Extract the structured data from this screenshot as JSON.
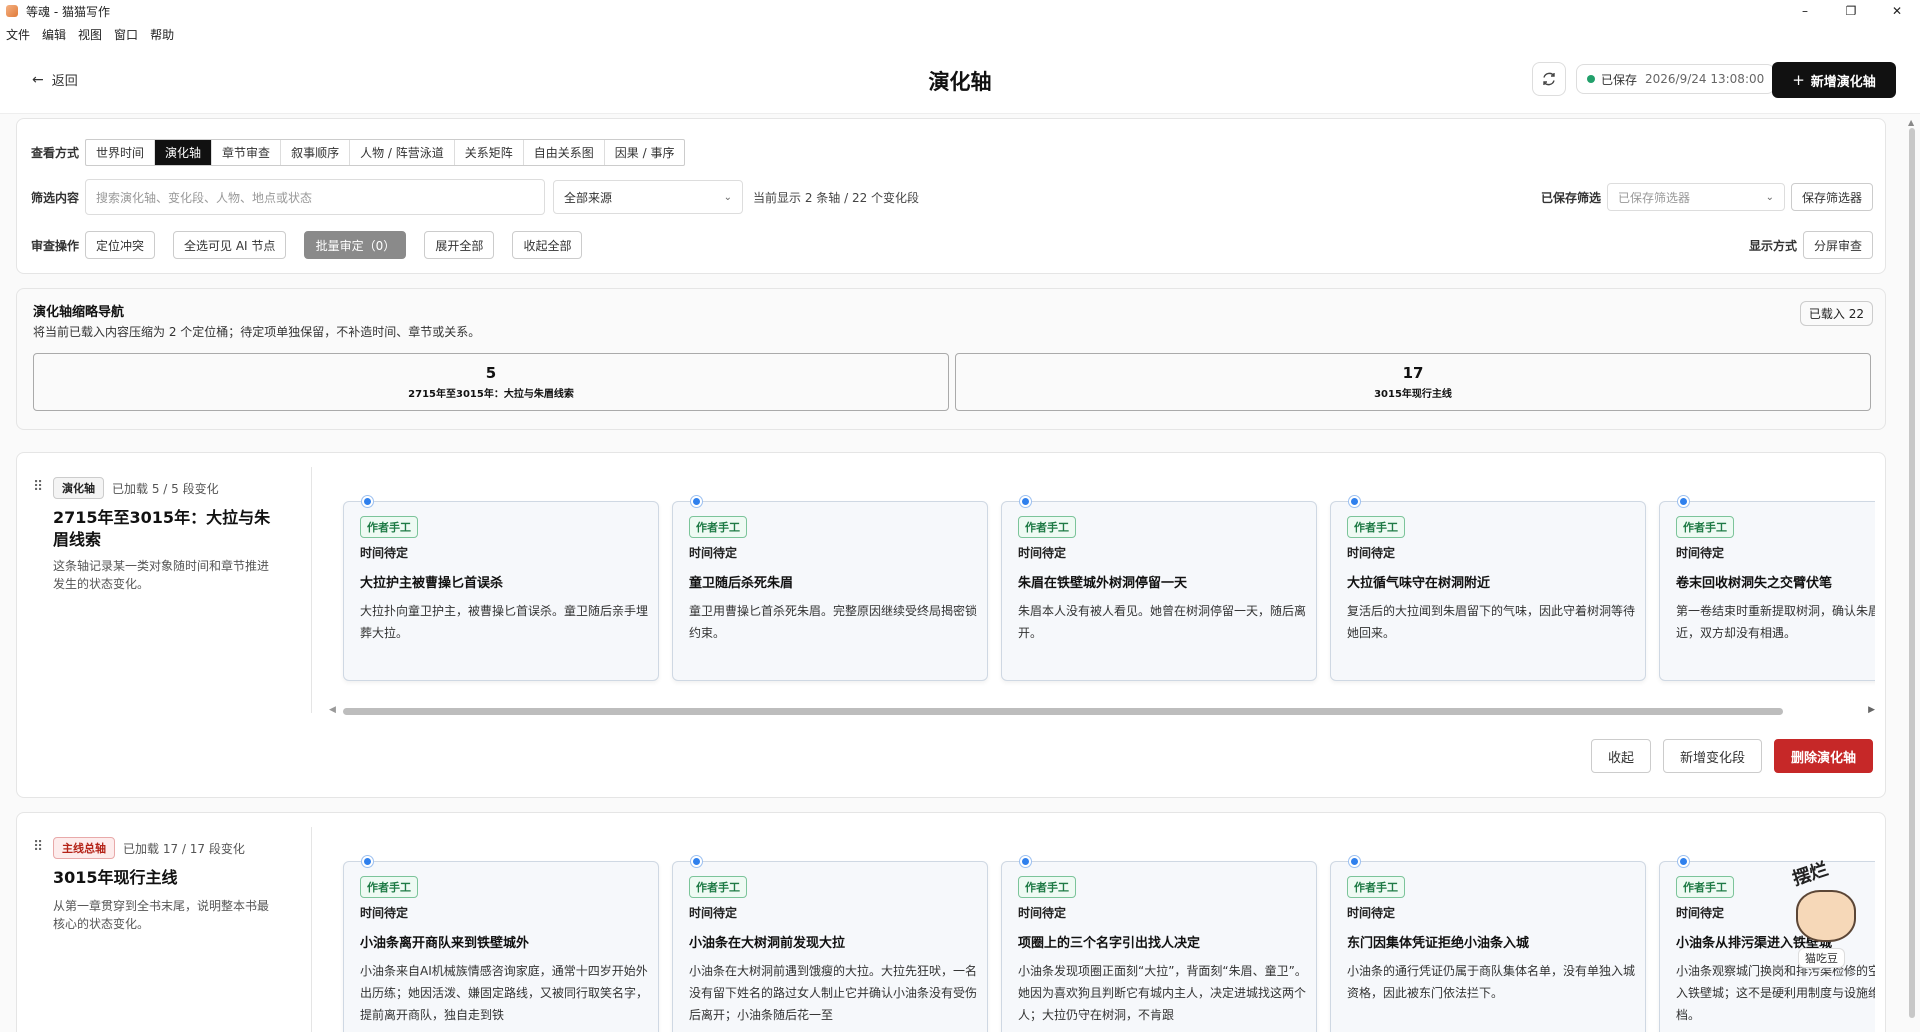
{
  "window": {
    "title": "等魂 - 猫猫写作",
    "controls": [
      "–",
      "❐",
      "✕"
    ]
  },
  "menu": [
    "文件",
    "编辑",
    "视图",
    "窗口",
    "帮助"
  ],
  "header": {
    "back_label": "返回",
    "title": "演化轴",
    "saved_label": "已保存",
    "saved_time": "2026/9/24 13:08:00",
    "new_axis_label": "新增演化轴",
    "status_color": "#22a06b"
  },
  "view_mode": {
    "label": "查看方式",
    "options": [
      "世界时间",
      "演化轴",
      "章节审查",
      "叙事顺序",
      "人物 / 阵营泳道",
      "关系矩阵",
      "自由关系图",
      "因果 / 事序"
    ],
    "active": "演化轴"
  },
  "filter": {
    "label": "筛选内容",
    "search_placeholder": "搜索演化轴、变化段、人物、地点或状态",
    "source_select": "全部来源",
    "count_text": "当前显示 2 条轴 / 22 个变化段",
    "saved_filters_label": "已保存筛选",
    "saved_filters_placeholder": "已保存筛选器",
    "save_filter_button": "保存筛选器"
  },
  "review": {
    "label": "审查操作",
    "buttons": [
      "定位冲突",
      "全选可见 AI 节点",
      "批量审定（0）",
      "展开全部",
      "收起全部"
    ],
    "display_label": "显示方式",
    "display_button": "分屏审查"
  },
  "nav": {
    "title": "演化轴缩略导航",
    "desc": "将当前已载入内容压缩为 2 个定位桶；待定项单独保留，不补造时间、章节或关系。",
    "loaded_badge": "已载入 22",
    "buckets": [
      {
        "count": "5",
        "label": "2715年至3015年：大拉与朱眉线索"
      },
      {
        "count": "17",
        "label": "3015年现行主线"
      }
    ]
  },
  "axes": [
    {
      "tag": "演化轴",
      "loaded": "已加载 5 / 5 段变化",
      "name": "2715年至3015年：大拉与朱眉线索",
      "desc": "这条轴记录某一类对象随时间和章节推进发生的状态变化。",
      "cards": [
        {
          "source": "作者手工",
          "time": "时间待定",
          "title": "大拉护主被曹操匕首误杀",
          "body": "大拉扑向童卫护主，被曹操匕首误杀。童卫随后亲手埋葬大拉。"
        },
        {
          "source": "作者手工",
          "time": "时间待定",
          "title": "童卫随后杀死朱眉",
          "body": "童卫用曹操匕首杀死朱眉。完整原因继续受终局揭密锁约束。"
        },
        {
          "source": "作者手工",
          "time": "时间待定",
          "title": "朱眉在铁壁城外树洞停留一天",
          "body": "朱眉本人没有被人看见。她曾在树洞停留一天，随后离开。"
        },
        {
          "source": "作者手工",
          "time": "时间待定",
          "title": "大拉循气味守在树洞附近",
          "body": "复活后的大拉闻到朱眉留下的气味，因此守着树洞等待她回来。"
        },
        {
          "source": "作者手工",
          "time": "时间待定",
          "title": "卷末回收树洞失之交臂伏笔",
          "body": "第一卷结束时重新提取树洞，确认朱眉来过，童卫很近，双方却没有相遇。"
        }
      ],
      "actions": [
        "收起",
        "新增变化段",
        "删除演化轴"
      ]
    },
    {
      "tag": "主线总轴",
      "loaded": "已加载 17 / 17 段变化",
      "name": "3015年现行主线",
      "desc": "从第一章贯穿到全书末尾，说明整本书最核心的状态变化。",
      "cards": [
        {
          "source": "作者手工",
          "time": "时间待定",
          "title": "小油条离开商队来到铁壁城外",
          "body": "小油条来自AI机械族情感咨询家庭，通常十四岁开始外出历练；她因活泼、嫌固定路线，又被同行取笑名字，提前离开商队，独自走到铁"
        },
        {
          "source": "作者手工",
          "time": "时间待定",
          "title": "小油条在大树洞前发现大拉",
          "body": "小油条在大树洞前遇到饿瘦的大拉。大拉先狂吠，一名没有留下姓名的路过女人制止它并确认小油条没有受伤后离开；小油条随后花一至"
        },
        {
          "source": "作者手工",
          "time": "时间待定",
          "title": "项圈上的三个名字引出找人决定",
          "body": "小油条发现项圈正面刻“大拉”，背面刻“朱眉、童卫”。她因为喜欢狗且判断它有城内主人，决定进城找这两个人；大拉仍守在树洞，不肯跟"
        },
        {
          "source": "作者手工",
          "time": "时间待定",
          "title": "东门因集体凭证拒绝小油条入城",
          "body": "小油条的通行凭证仍属于商队集体名单，没有单独入城资格，因此被东门依法拦下。"
        },
        {
          "source": "作者手工",
          "time": "时间待定",
          "title": "小油条从排污渠进入铁壁城",
          "body": "小油条观察城门换岗和排污渠检修的空隙，从排污渠进入铁壁城；这不是硬利用制度与设施维护之间的短暂空档。"
        }
      ],
      "actions": []
    }
  ],
  "mascot": {
    "text": "摆烂",
    "caption": "猫吃豆"
  }
}
